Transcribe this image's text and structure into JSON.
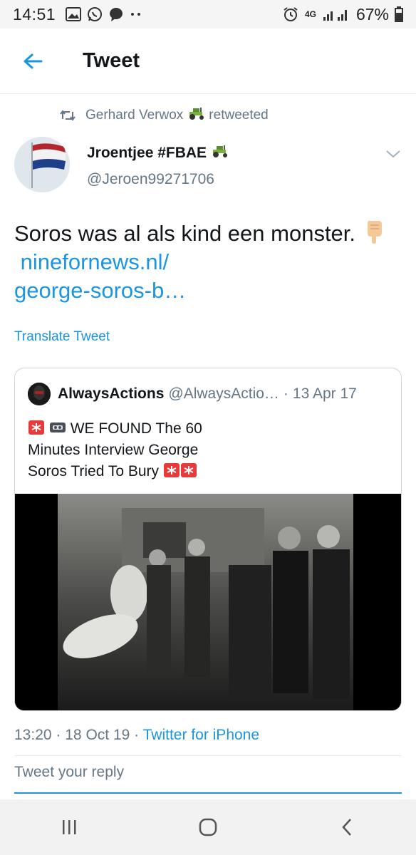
{
  "statusbar": {
    "time": "14:51",
    "network": "4G",
    "battery": "67%"
  },
  "header": {
    "title": "Tweet"
  },
  "retweet": {
    "user": "Gerhard Verwox",
    "suffix": "retweeted"
  },
  "author": {
    "name": "Jroentjee #FBAE",
    "handle": "@Jeroen99271706"
  },
  "tweet": {
    "text_part1": "Soros was al als kind een monster. ",
    "link_part1": "ninefornews.nl/",
    "link_part2": "george-soros-b…",
    "translate": "Translate Tweet"
  },
  "quote": {
    "name": "AlwaysActions",
    "handle": "@AlwaysActio…",
    "sep": "·",
    "date": "13 Apr 17",
    "text_line1": "WE FOUND The 60",
    "text_line2": "Minutes Interview George",
    "text_line3": "Soros Tried To Bury"
  },
  "meta": {
    "time": "13:20",
    "sep1": "·",
    "date": "18 Oct 19",
    "sep2": "·",
    "via": "Twitter for iPhone"
  },
  "reply": {
    "placeholder": "Tweet your reply"
  },
  "colors": {
    "accent": "#1b95e0",
    "secondary": "#657786",
    "text": "#14171a"
  },
  "icons": [
    "back-arrow-icon",
    "retweet-icon",
    "tractor-icon",
    "chevron-down-icon",
    "pointing-down-icon",
    "siren-icon",
    "videotape-icon",
    "recents-icon",
    "home-icon",
    "back-nav-icon"
  ]
}
